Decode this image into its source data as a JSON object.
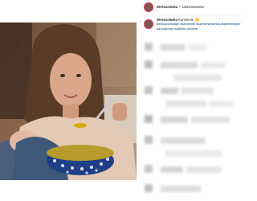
{
  "post": {
    "header": {
      "username": "dereszowska",
      "separator": "•",
      "follow_label": "Obserwowanie"
    },
    "caption": {
      "username": "dereszowska",
      "text": "Karmienie",
      "hashtags": "#hellojuiceshape #karmienie #karmieniepiersia #karmieniepiersia #zdrowie #dziecko #mama"
    },
    "image": {
      "description_icon": "post-photo"
    }
  }
}
